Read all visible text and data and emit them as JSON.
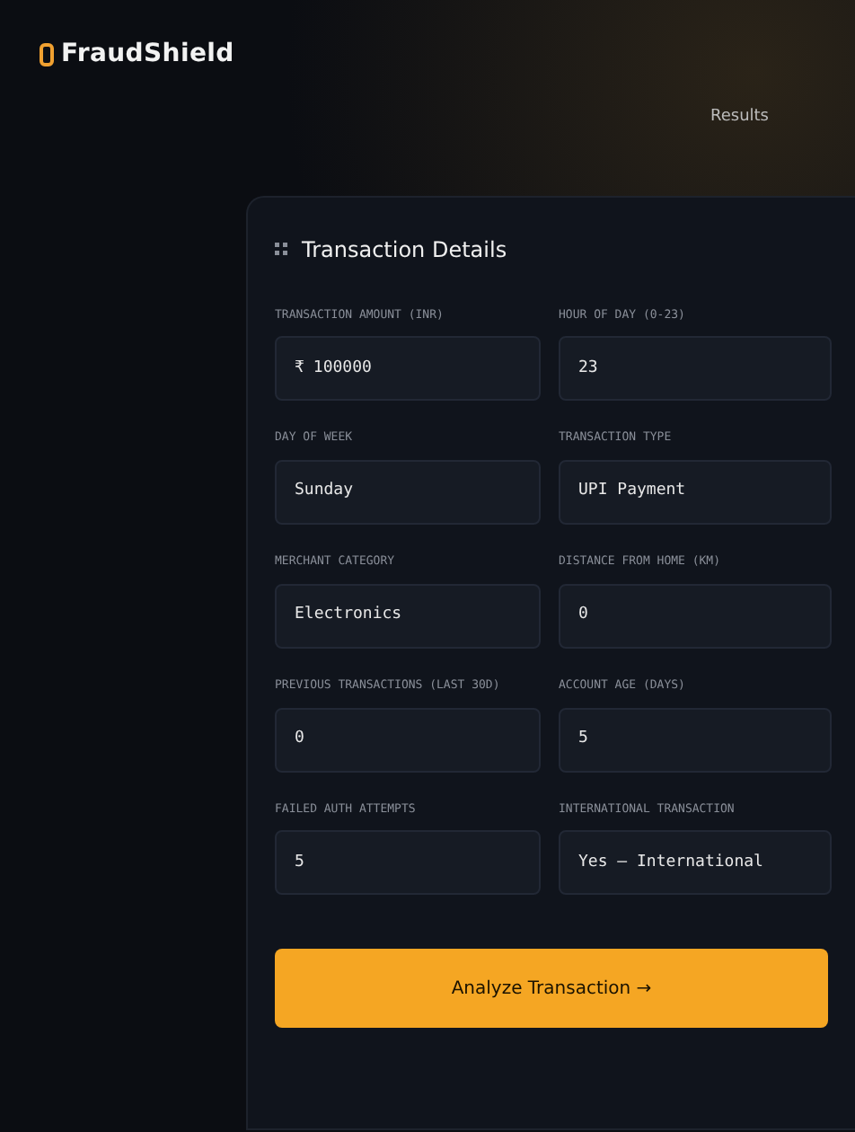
{
  "brand": {
    "name": "FraudShield"
  },
  "nav": {
    "link": "Results"
  },
  "form": {
    "title": "Transaction Details",
    "fields": [
      {
        "label": "TRANSACTION AMOUNT (INR)",
        "prefix": "₹",
        "value": "100000"
      },
      {
        "label": "HOUR OF DAY (0-23)",
        "value": "23"
      },
      {
        "label": "DAY OF WEEK",
        "value": "Sunday"
      },
      {
        "label": "TRANSACTION TYPE",
        "value": "UPI Payment"
      },
      {
        "label": "MERCHANT CATEGORY",
        "value": "Electronics"
      },
      {
        "label": "DISTANCE FROM HOME (KM)",
        "value": "0"
      },
      {
        "label": "PREVIOUS TRANSACTIONS (LAST 30D)",
        "value": "0"
      },
      {
        "label": "ACCOUNT AGE (DAYS)",
        "value": "5"
      },
      {
        "label": "FAILED AUTH ATTEMPTS",
        "value": "5"
      },
      {
        "label": "INTERNATIONAL TRANSACTION",
        "value": "Yes – International"
      }
    ],
    "button": "Analyze Transaction →"
  }
}
